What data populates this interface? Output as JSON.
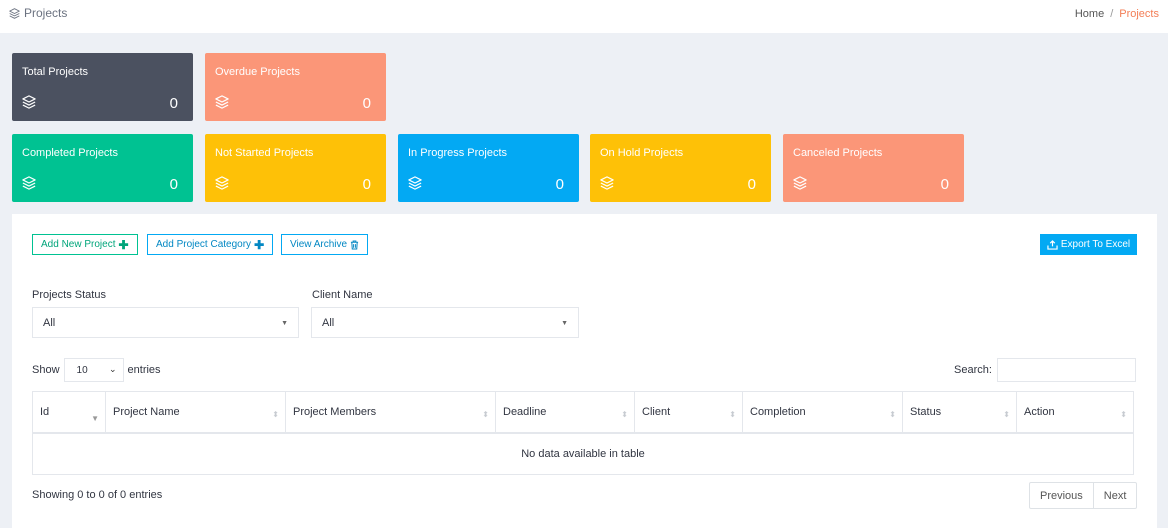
{
  "header": {
    "title": "Projects",
    "title_icon": "layers-icon",
    "breadcrumb": {
      "home": "Home",
      "sep": "/",
      "current": "Projects"
    }
  },
  "stats": [
    {
      "label": "Total Projects",
      "value": "0",
      "color": "#4b5160"
    },
    {
      "label": "Overdue Projects",
      "value": "0",
      "color": "#fb9678"
    },
    {
      "label": "Completed Projects",
      "value": "0",
      "color": "#00c292"
    },
    {
      "label": "Not Started Projects",
      "value": "0",
      "color": "#fec107"
    },
    {
      "label": "In Progress Projects",
      "value": "0",
      "color": "#03a9f3"
    },
    {
      "label": "On Hold Projects",
      "value": "0",
      "color": "#fec107"
    },
    {
      "label": "Canceled Projects",
      "value": "0",
      "color": "#fb9678"
    }
  ],
  "actions": {
    "add_project": "Add New Project",
    "add_category": "Add Project Category",
    "view_archive": "View Archive",
    "export": "Export To Excel"
  },
  "filters": {
    "status_label": "Projects Status",
    "status_value": "All",
    "client_label": "Client Name",
    "client_value": "All"
  },
  "table": {
    "show_label": "Show",
    "entries_value": "10",
    "entries_label": "entries",
    "search_label": "Search:",
    "columns": [
      "Id",
      "Project Name",
      "Project Members",
      "Deadline",
      "Client",
      "Completion",
      "Status",
      "Action"
    ],
    "empty_text": "No data available in table",
    "info": "Showing 0 to 0 of 0 entries",
    "prev": "Previous",
    "next": "Next"
  }
}
